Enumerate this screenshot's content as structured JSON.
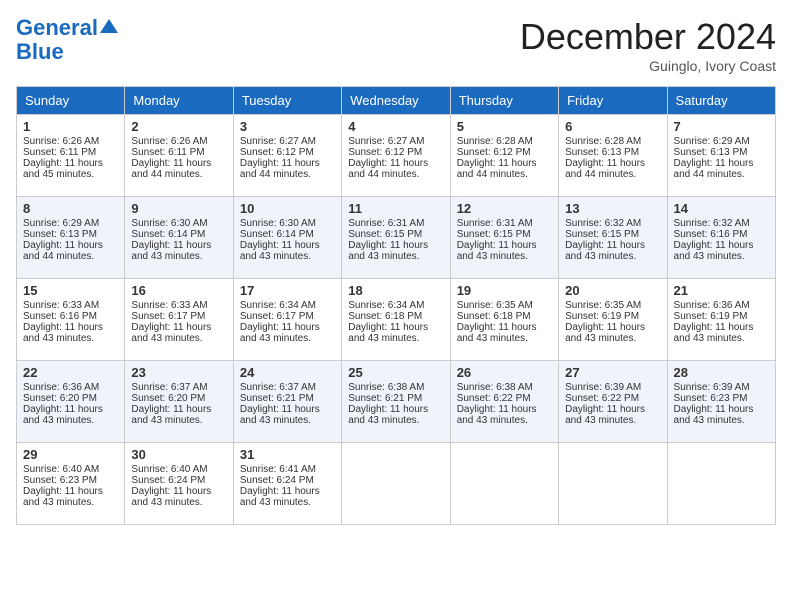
{
  "header": {
    "logo_line1": "General",
    "logo_line2": "Blue",
    "month_title": "December 2024",
    "subtitle": "Guinglo, Ivory Coast"
  },
  "days_of_week": [
    "Sunday",
    "Monday",
    "Tuesday",
    "Wednesday",
    "Thursday",
    "Friday",
    "Saturday"
  ],
  "weeks": [
    [
      {
        "day": 1,
        "sunrise": "6:26 AM",
        "sunset": "6:11 PM",
        "daylight": "11 hours and 45 minutes."
      },
      {
        "day": 2,
        "sunrise": "6:26 AM",
        "sunset": "6:11 PM",
        "daylight": "11 hours and 44 minutes."
      },
      {
        "day": 3,
        "sunrise": "6:27 AM",
        "sunset": "6:12 PM",
        "daylight": "11 hours and 44 minutes."
      },
      {
        "day": 4,
        "sunrise": "6:27 AM",
        "sunset": "6:12 PM",
        "daylight": "11 hours and 44 minutes."
      },
      {
        "day": 5,
        "sunrise": "6:28 AM",
        "sunset": "6:12 PM",
        "daylight": "11 hours and 44 minutes."
      },
      {
        "day": 6,
        "sunrise": "6:28 AM",
        "sunset": "6:13 PM",
        "daylight": "11 hours and 44 minutes."
      },
      {
        "day": 7,
        "sunrise": "6:29 AM",
        "sunset": "6:13 PM",
        "daylight": "11 hours and 44 minutes."
      }
    ],
    [
      {
        "day": 8,
        "sunrise": "6:29 AM",
        "sunset": "6:13 PM",
        "daylight": "11 hours and 44 minutes."
      },
      {
        "day": 9,
        "sunrise": "6:30 AM",
        "sunset": "6:14 PM",
        "daylight": "11 hours and 43 minutes."
      },
      {
        "day": 10,
        "sunrise": "6:30 AM",
        "sunset": "6:14 PM",
        "daylight": "11 hours and 43 minutes."
      },
      {
        "day": 11,
        "sunrise": "6:31 AM",
        "sunset": "6:15 PM",
        "daylight": "11 hours and 43 minutes."
      },
      {
        "day": 12,
        "sunrise": "6:31 AM",
        "sunset": "6:15 PM",
        "daylight": "11 hours and 43 minutes."
      },
      {
        "day": 13,
        "sunrise": "6:32 AM",
        "sunset": "6:15 PM",
        "daylight": "11 hours and 43 minutes."
      },
      {
        "day": 14,
        "sunrise": "6:32 AM",
        "sunset": "6:16 PM",
        "daylight": "11 hours and 43 minutes."
      }
    ],
    [
      {
        "day": 15,
        "sunrise": "6:33 AM",
        "sunset": "6:16 PM",
        "daylight": "11 hours and 43 minutes."
      },
      {
        "day": 16,
        "sunrise": "6:33 AM",
        "sunset": "6:17 PM",
        "daylight": "11 hours and 43 minutes."
      },
      {
        "day": 17,
        "sunrise": "6:34 AM",
        "sunset": "6:17 PM",
        "daylight": "11 hours and 43 minutes."
      },
      {
        "day": 18,
        "sunrise": "6:34 AM",
        "sunset": "6:18 PM",
        "daylight": "11 hours and 43 minutes."
      },
      {
        "day": 19,
        "sunrise": "6:35 AM",
        "sunset": "6:18 PM",
        "daylight": "11 hours and 43 minutes."
      },
      {
        "day": 20,
        "sunrise": "6:35 AM",
        "sunset": "6:19 PM",
        "daylight": "11 hours and 43 minutes."
      },
      {
        "day": 21,
        "sunrise": "6:36 AM",
        "sunset": "6:19 PM",
        "daylight": "11 hours and 43 minutes."
      }
    ],
    [
      {
        "day": 22,
        "sunrise": "6:36 AM",
        "sunset": "6:20 PM",
        "daylight": "11 hours and 43 minutes."
      },
      {
        "day": 23,
        "sunrise": "6:37 AM",
        "sunset": "6:20 PM",
        "daylight": "11 hours and 43 minutes."
      },
      {
        "day": 24,
        "sunrise": "6:37 AM",
        "sunset": "6:21 PM",
        "daylight": "11 hours and 43 minutes."
      },
      {
        "day": 25,
        "sunrise": "6:38 AM",
        "sunset": "6:21 PM",
        "daylight": "11 hours and 43 minutes."
      },
      {
        "day": 26,
        "sunrise": "6:38 AM",
        "sunset": "6:22 PM",
        "daylight": "11 hours and 43 minutes."
      },
      {
        "day": 27,
        "sunrise": "6:39 AM",
        "sunset": "6:22 PM",
        "daylight": "11 hours and 43 minutes."
      },
      {
        "day": 28,
        "sunrise": "6:39 AM",
        "sunset": "6:23 PM",
        "daylight": "11 hours and 43 minutes."
      }
    ],
    [
      {
        "day": 29,
        "sunrise": "6:40 AM",
        "sunset": "6:23 PM",
        "daylight": "11 hours and 43 minutes."
      },
      {
        "day": 30,
        "sunrise": "6:40 AM",
        "sunset": "6:24 PM",
        "daylight": "11 hours and 43 minutes."
      },
      {
        "day": 31,
        "sunrise": "6:41 AM",
        "sunset": "6:24 PM",
        "daylight": "11 hours and 43 minutes."
      },
      null,
      null,
      null,
      null
    ]
  ]
}
